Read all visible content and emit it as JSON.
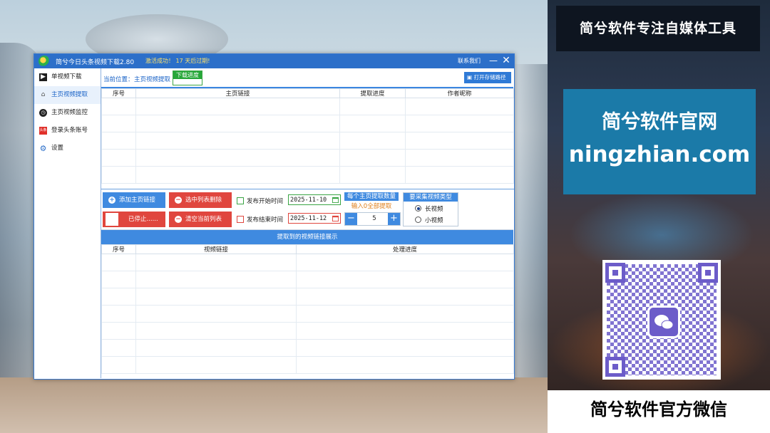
{
  "window": {
    "title": "简兮今日头条视频下载2.80",
    "activation_msg": "激活成功！ 17 天后过期!",
    "contact": "联系我们",
    "minimize": "—",
    "close": "✕"
  },
  "sidebar": {
    "items": [
      {
        "label": "单视频下载",
        "icon": "clapper-icon"
      },
      {
        "label": "主页视频提取",
        "icon": "home-icon"
      },
      {
        "label": "主页视频监控",
        "icon": "monitor-icon"
      },
      {
        "label": "登录头条账号",
        "icon": "toutiao-icon"
      },
      {
        "label": "设置",
        "icon": "gear-icon"
      }
    ]
  },
  "breadcrumb": {
    "label": "当前位置：",
    "value": "主页视频提取",
    "download_tab": "下载进度",
    "open_dir_button": "打开存储路径"
  },
  "top_table": {
    "columns": [
      "序号",
      "主页链接",
      "提取进度",
      "作者昵称"
    ]
  },
  "controls": {
    "add_button": "添加主页链接",
    "delete_button": "选中列表删除",
    "clear_button": "清空当前列表",
    "stopped_button": "已停止......",
    "start_time_label": "发布开始时间",
    "end_time_label": "发布结束时间",
    "start_date": "2025-11-10",
    "end_date": "2025-11-12",
    "count_title": "每个主页提取数量",
    "count_hint": "输入0全部提取",
    "count_value": "5",
    "type_title": "要采集视频类型",
    "type_options": [
      "长视频",
      "小视频"
    ],
    "type_selected": "长视频"
  },
  "bottom_section": {
    "header": "提取到的视频链接展示",
    "columns": [
      "序号",
      "视频链接",
      "处理进度"
    ]
  },
  "promo": {
    "top_banner": "简兮软件专注自媒体工具",
    "site_name": "简兮软件官网",
    "site_url": "ningzhian.com",
    "bottom_banner": "简兮软件官方微信"
  },
  "colors": {
    "primary": "#2c6fc9",
    "button_blue": "#3f8ae0",
    "button_red": "#e0463e",
    "green": "#27a739",
    "hint_orange": "#e07f1a"
  }
}
